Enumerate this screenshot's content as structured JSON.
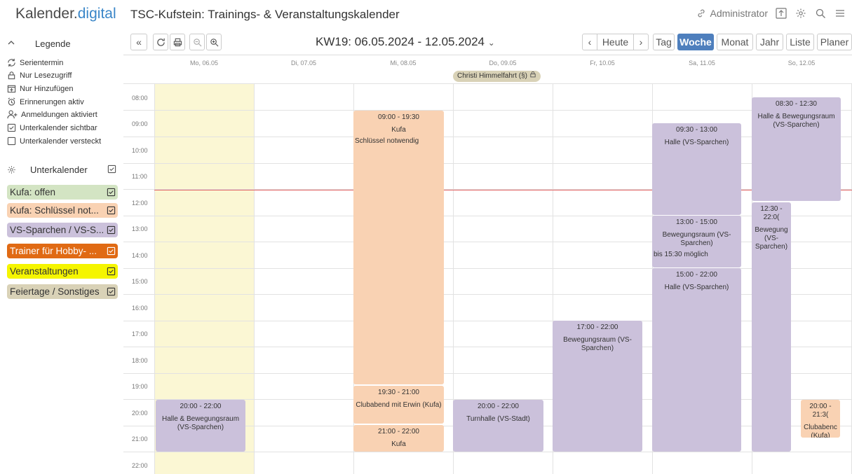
{
  "header": {
    "logo_main": "Kalender.",
    "logo_accent": "digital",
    "page_title": "TSC-Kufstein: Trainings- & Veranstaltungskalender",
    "user_label": "Administrator"
  },
  "sidebar": {
    "legend_title": "Legende",
    "legend_items": [
      {
        "label": "Serientermin",
        "icon": "repeat-icon"
      },
      {
        "label": "Nur Lesezugriff",
        "icon": "lock-icon"
      },
      {
        "label": "Nur Hinzufügen",
        "icon": "calendar-plus-icon"
      },
      {
        "label": "Erinnerungen aktiv",
        "icon": "alarm-icon"
      },
      {
        "label": "Anmeldungen aktiviert",
        "icon": "user-add-icon"
      },
      {
        "label": "Unterkalender sichtbar",
        "icon": "checkbox-checked-icon"
      },
      {
        "label": "Unterkalender versteckt",
        "icon": "checkbox-empty-icon"
      }
    ],
    "subcal_title": "Unterkalender",
    "subcalendars": [
      {
        "label": "Kufa: offen",
        "color": "#d3e4c3"
      },
      {
        "label": "Kufa: Schlüssel not...",
        "color": "#f9d2b3"
      },
      {
        "label": "VS-Sparchen / VS-S...",
        "color": "#cbc1db"
      },
      {
        "label": "Trainer für Hobby- ...",
        "color": "#e06a14"
      },
      {
        "label": "Veranstaltungen",
        "color": "#f5f500"
      },
      {
        "label": "Feiertage / Sonstiges",
        "color": "#d9d2b7"
      }
    ]
  },
  "toolbar": {
    "week_label": "KW19: 06.05.2024 - 12.05.2024",
    "today_label": "Heute",
    "views": [
      "Tag",
      "Woche",
      "Monat",
      "Jahr",
      "Liste",
      "Planer"
    ],
    "active_view": "Woche"
  },
  "calendar": {
    "days": [
      "Mo, 06.05",
      "Di, 07.05",
      "Mi, 08.05",
      "Do, 09.05",
      "Fr, 10.05",
      "Sa, 11.05",
      "So, 12.05"
    ],
    "allday_event": "Christi Himmelfahrt (§)",
    "hours": [
      "08:00",
      "09:00",
      "10:00",
      "11:00",
      "12:00",
      "13:00",
      "14:00",
      "15:00",
      "16:00",
      "17:00",
      "18:00",
      "19:00",
      "20:00",
      "21:00",
      "22:00"
    ],
    "events": [
      {
        "time": "20:00 - 22:00",
        "title": "Halle & Bewegungsraum (VS-Sparchen)",
        "note": ""
      },
      {
        "time": "09:00 - 19:30",
        "title": "Kufa",
        "note": "Schlüssel notwendig"
      },
      {
        "time": "19:30 - 21:00",
        "title": "Clubabend mit Erwin (Kufa)",
        "note": ""
      },
      {
        "time": "21:00 - 22:00",
        "title": "Kufa",
        "note": ""
      },
      {
        "time": "20:00 - 22:00",
        "title": "Turnhalle (VS-Stadt)",
        "note": ""
      },
      {
        "time": "17:00 - 22:00",
        "title": "Bewegungsraum (VS-Sparchen)",
        "note": ""
      },
      {
        "time": "09:30 - 13:00",
        "title": "Halle (VS-Sparchen)",
        "note": ""
      },
      {
        "time": "13:00 - 15:00",
        "title": "Bewegungsraum (VS-Sparchen)",
        "note": "bis 15:30 möglich"
      },
      {
        "time": "15:00 - 22:00",
        "title": "Halle (VS-Sparchen)",
        "note": ""
      },
      {
        "time": "08:30 - 12:30",
        "title": "Halle & Bewegungsraum (VS-Sparchen)",
        "note": ""
      },
      {
        "time": "12:30 - 22:0(",
        "title": "Bewegung (VS-Sparchen)",
        "note": ""
      },
      {
        "time": "20:00 - 21:3(",
        "title": "Clubabenc (Kufa)",
        "note": ""
      }
    ]
  }
}
